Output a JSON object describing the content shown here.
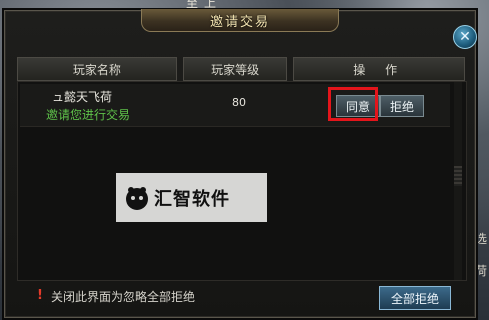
{
  "background": {
    "top_text": "至上",
    "side_text_1": "选",
    "side_text_2": "荷"
  },
  "dialog": {
    "title": "邀请交易",
    "close_label": "✕"
  },
  "table": {
    "headers": {
      "name": "玩家名称",
      "level": "玩家等级",
      "action": "操 作"
    },
    "rows": [
      {
        "player_name": "ュ懿天飞荷",
        "invite_text": "邀请您进行交易",
        "level": "80",
        "agree_label": "同意",
        "refuse_label": "拒绝"
      }
    ]
  },
  "footer": {
    "warning_icon": "!",
    "message": "关闭此界面为忽略全部拒绝",
    "refuse_all_label": "全部拒绝"
  },
  "watermark": {
    "text": "汇智软件"
  },
  "colors": {
    "title_text": "#f2e3b0",
    "invite_text": "#5fc24a",
    "highlight": "#e4151b",
    "warning": "#e43a2a"
  }
}
